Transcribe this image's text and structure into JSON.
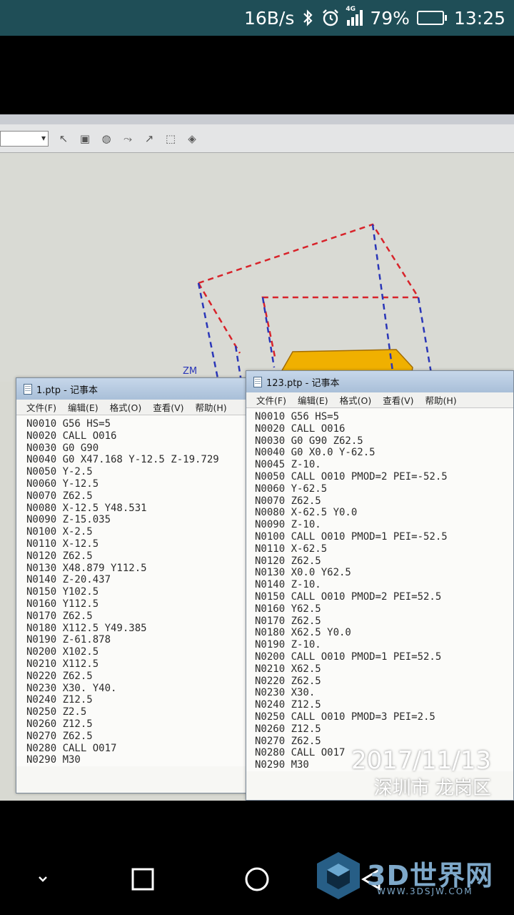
{
  "status_bar": {
    "net_speed": "16B/s",
    "network_type": "4G",
    "battery": "79%",
    "battery_level": 0.79,
    "time": "13:25",
    "icons": [
      "bluetooth-icon",
      "alarm-icon",
      "signal-icon",
      "battery-icon"
    ]
  },
  "notepad1": {
    "title": "1.ptp - 记事本",
    "menu": [
      "文件(F)",
      "编辑(E)",
      "格式(O)",
      "查看(V)",
      "帮助(H)"
    ],
    "lines": [
      "N0010 G56 HS=5",
      "N0020 CALL O016",
      "N0030 G0 G90",
      "N0040 G0 X47.168 Y-12.5 Z-19.729",
      "N0050 Y-2.5",
      "N0060 Y-12.5",
      "N0070 Z62.5",
      "N0080 X-12.5 Y48.531",
      "N0090 Z-15.035",
      "N0100 X-2.5",
      "N0110 X-12.5",
      "N0120 Z62.5",
      "N0130 X48.879 Y112.5",
      "N0140 Z-20.437",
      "N0150 Y102.5",
      "N0160 Y112.5",
      "N0170 Z62.5",
      "N0180 X112.5 Y49.385",
      "N0190 Z-61.878",
      "N0200 X102.5",
      "N0210 X112.5",
      "N0220 Z62.5",
      "N0230 X30. Y40.",
      "N0240 Z12.5",
      "N0250 Z2.5",
      "N0260 Z12.5",
      "N0270 Z62.5",
      "N0280 CALL O017",
      "N0290 M30"
    ]
  },
  "notepad2": {
    "title": "123.ptp - 记事本",
    "menu": [
      "文件(F)",
      "编辑(E)",
      "格式(O)",
      "查看(V)",
      "帮助(H)"
    ],
    "lines": [
      "N0010 G56 HS=5",
      "N0020 CALL O016",
      "N0030 G0 G90 Z62.5",
      "N0040 G0 X0.0 Y-62.5",
      "N0045 Z-10.",
      "N0050 CALL O010 PMOD=2 PEI=-52.5",
      "N0060 Y-62.5",
      "N0070 Z62.5",
      "N0080 X-62.5 Y0.0",
      "N0090 Z-10.",
      "N0100 CALL O010 PMOD=1 PEI=-52.5",
      "N0110 X-62.5",
      "N0120 Z62.5",
      "N0130 X0.0 Y62.5",
      "N0140 Z-10.",
      "N0150 CALL O010 PMOD=2 PEI=52.5",
      "N0160 Y62.5",
      "N0170 Z62.5",
      "N0180 X62.5 Y0.0",
      "N0190 Z-10.",
      "N0200 CALL O010 PMOD=1 PEI=52.5",
      "N0210 X62.5",
      "N0220 Z62.5",
      "N0230 X30.",
      "N0240 Z12.5",
      "N0250 CALL O010 PMOD=3 PEI=2.5",
      "N0260 Z12.5",
      "N0270 Z62.5",
      "N0280 CALL O017",
      "N0290 M30"
    ]
  },
  "cad": {
    "axis_label": "ZM",
    "colors": {
      "toolpath_red": "#d8232a",
      "toolpath_blue": "#2a36b8",
      "part_orange": "#f0b000"
    }
  },
  "watermark": {
    "date": "2017/11/13",
    "location": "深圳市 龙岗区"
  },
  "logo": {
    "name": "3D世界网",
    "url": "WWW.3DSJW.COM"
  },
  "colors": {
    "status_bar_bg": "#1f4e57",
    "notepad_title_bg": "#b8cbe1"
  }
}
